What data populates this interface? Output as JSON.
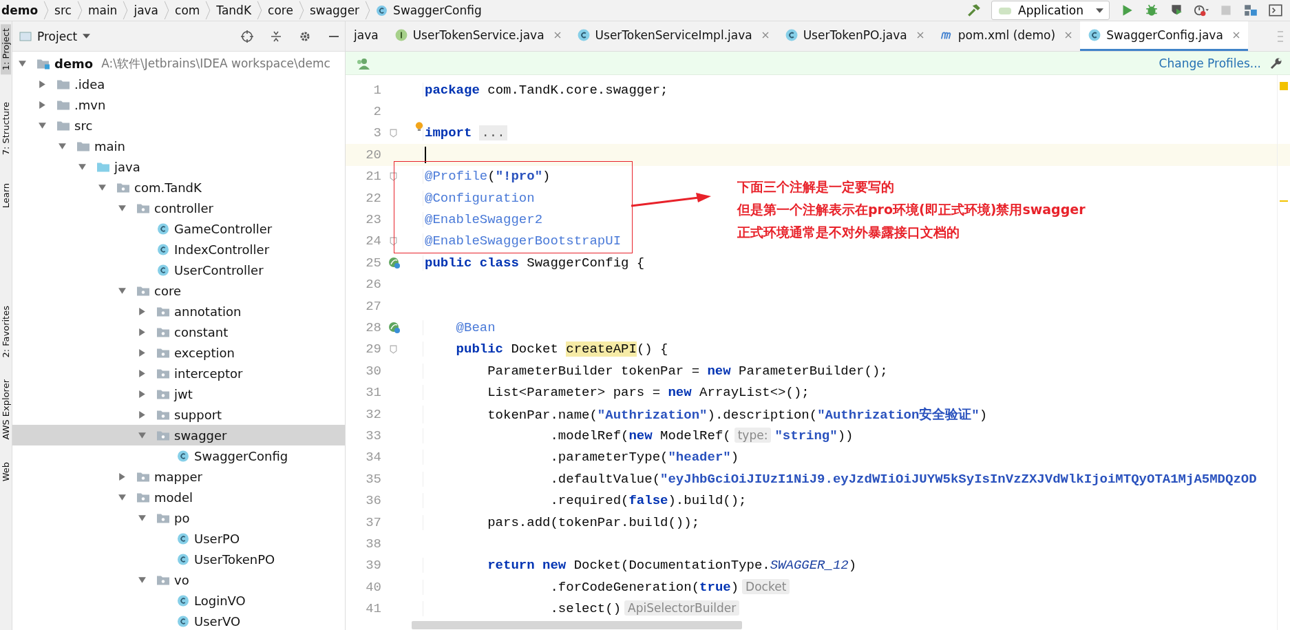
{
  "breadcrumbs": [
    {
      "label": "demo",
      "kind": "module"
    },
    {
      "label": "src",
      "kind": "folder"
    },
    {
      "label": "main",
      "kind": "folder"
    },
    {
      "label": "java",
      "kind": "folder"
    },
    {
      "label": "com",
      "kind": "folder"
    },
    {
      "label": "TandK",
      "kind": "folder"
    },
    {
      "label": "core",
      "kind": "folder"
    },
    {
      "label": "swagger",
      "kind": "folder"
    },
    {
      "label": "SwaggerConfig",
      "kind": "class"
    }
  ],
  "run_config": {
    "label": "Application"
  },
  "side_tabs": [
    {
      "label": "1: Project",
      "selected": true
    },
    {
      "label": "7: Structure",
      "selected": false
    },
    {
      "label": "Learn",
      "selected": false
    },
    {
      "label": "2: Favorites",
      "selected": false
    },
    {
      "label": "AWS Explorer",
      "selected": false
    },
    {
      "label": "Web",
      "selected": false
    }
  ],
  "project": {
    "title": "Project",
    "tree": [
      {
        "label": "demo",
        "kind": "module",
        "path": "A:\\软件\\Jetbrains\\IDEA workspace\\demc",
        "expanded": true,
        "selected": false,
        "children": [
          {
            "label": ".idea",
            "kind": "folder",
            "expanded": false,
            "selected": false
          },
          {
            "label": ".mvn",
            "kind": "folder",
            "expanded": false,
            "selected": false
          },
          {
            "label": "src",
            "kind": "folder",
            "expanded": true,
            "selected": false,
            "children": [
              {
                "label": "main",
                "kind": "folder",
                "expanded": true,
                "selected": false,
                "children": [
                  {
                    "label": "java",
                    "kind": "source",
                    "expanded": true,
                    "selected": false,
                    "children": [
                      {
                        "label": "com.TandK",
                        "kind": "package",
                        "expanded": true,
                        "selected": false,
                        "children": [
                          {
                            "label": "controller",
                            "kind": "package",
                            "expanded": true,
                            "selected": false,
                            "children": [
                              {
                                "label": "GameController",
                                "kind": "class",
                                "selected": false
                              },
                              {
                                "label": "IndexController",
                                "kind": "class",
                                "selected": false
                              },
                              {
                                "label": "UserController",
                                "kind": "class",
                                "selected": false
                              }
                            ]
                          },
                          {
                            "label": "core",
                            "kind": "package",
                            "expanded": true,
                            "selected": false,
                            "children": [
                              {
                                "label": "annotation",
                                "kind": "package",
                                "expanded": false,
                                "selected": false
                              },
                              {
                                "label": "constant",
                                "kind": "package",
                                "expanded": false,
                                "selected": false
                              },
                              {
                                "label": "exception",
                                "kind": "package",
                                "expanded": false,
                                "selected": false
                              },
                              {
                                "label": "interceptor",
                                "kind": "package",
                                "expanded": false,
                                "selected": false
                              },
                              {
                                "label": "jwt",
                                "kind": "package",
                                "expanded": false,
                                "selected": false
                              },
                              {
                                "label": "support",
                                "kind": "package",
                                "expanded": false,
                                "selected": false
                              },
                              {
                                "label": "swagger",
                                "kind": "package",
                                "expanded": true,
                                "selected": true,
                                "children": [
                                  {
                                    "label": "SwaggerConfig",
                                    "kind": "class",
                                    "selected": false
                                  }
                                ]
                              }
                            ]
                          },
                          {
                            "label": "mapper",
                            "kind": "package",
                            "expanded": false,
                            "selected": false
                          },
                          {
                            "label": "model",
                            "kind": "package",
                            "expanded": true,
                            "selected": false,
                            "children": [
                              {
                                "label": "po",
                                "kind": "package",
                                "expanded": true,
                                "selected": false,
                                "children": [
                                  {
                                    "label": "UserPO",
                                    "kind": "class",
                                    "selected": false
                                  },
                                  {
                                    "label": "UserTokenPO",
                                    "kind": "class",
                                    "selected": false
                                  }
                                ]
                              },
                              {
                                "label": "vo",
                                "kind": "package",
                                "expanded": true,
                                "selected": false,
                                "children": [
                                  {
                                    "label": "LoginVO",
                                    "kind": "class",
                                    "selected": false
                                  },
                                  {
                                    "label": "UserVO",
                                    "kind": "class",
                                    "selected": false
                                  }
                                ]
                              }
                            ]
                          }
                        ]
                      }
                    ]
                  }
                ]
              }
            ]
          }
        ]
      }
    ]
  },
  "tabs": [
    {
      "label": "java",
      "kind": "plain",
      "closable": false,
      "selected": false
    },
    {
      "label": "UserTokenService.java",
      "kind": "interface",
      "closable": true,
      "selected": false
    },
    {
      "label": "UserTokenServiceImpl.java",
      "kind": "class",
      "closable": true,
      "selected": false
    },
    {
      "label": "UserTokenPO.java",
      "kind": "class",
      "closable": true,
      "selected": false
    },
    {
      "label": "pom.xml (demo)",
      "kind": "maven",
      "closable": true,
      "selected": false
    },
    {
      "label": "SwaggerConfig.java",
      "kind": "class",
      "closable": true,
      "selected": true
    }
  ],
  "banner": {
    "link": "Change Profiles..."
  },
  "lines": [
    {
      "number": "1",
      "kind": "plain",
      "current": false,
      "intention": false,
      "tokens": [
        {
          "kind": "kw",
          "text": "package"
        },
        {
          "kind": "txt",
          "text": " com.TandK.core.swagger;"
        }
      ]
    },
    {
      "number": "2",
      "kind": "plain",
      "current": false,
      "intention": false
    },
    {
      "number": "3",
      "kind": "fold",
      "current": false,
      "intention": true,
      "tokens": [
        {
          "kind": "kw",
          "text": "import"
        },
        {
          "kind": "fold",
          "text": "..."
        }
      ]
    },
    {
      "number": "20",
      "kind": "plain",
      "current": true,
      "intention": false
    },
    {
      "number": "21",
      "kind": "fold",
      "current": false,
      "intention": false,
      "tokens": [
        {
          "kind": "ann",
          "text": "@Profile"
        },
        {
          "kind": "txt",
          "text": "("
        },
        {
          "kind": "str",
          "text": "\"!pro\""
        },
        {
          "kind": "txt",
          "text": ")"
        }
      ]
    },
    {
      "number": "22",
      "kind": "plain",
      "current": false,
      "intention": false,
      "tokens": [
        {
          "kind": "ann",
          "text": "@Configuration"
        }
      ]
    },
    {
      "number": "23",
      "kind": "plain",
      "current": false,
      "intention": false,
      "tokens": [
        {
          "kind": "ann",
          "text": "@EnableSwagger2"
        }
      ]
    },
    {
      "number": "24",
      "kind": "fold",
      "current": false,
      "intention": false,
      "tokens": [
        {
          "kind": "ann",
          "text": "@EnableSwaggerBootstrapUI"
        }
      ]
    },
    {
      "number": "25",
      "kind": "bean",
      "current": false,
      "intention": false,
      "tokens": [
        {
          "kind": "kw",
          "text": "public class"
        },
        {
          "kind": "txt",
          "text": " SwaggerConfig {"
        }
      ]
    },
    {
      "number": "26",
      "kind": "plain",
      "current": false,
      "intention": false
    },
    {
      "number": "27",
      "kind": "plain",
      "current": false,
      "intention": false
    },
    {
      "number": "28",
      "kind": "bean",
      "current": false,
      "intention": false,
      "tokens": [
        {
          "kind": "ann",
          "text": "    @Bean"
        }
      ]
    },
    {
      "number": "29",
      "kind": "fold",
      "current": false,
      "intention": false,
      "tokens": [
        {
          "kind": "kw",
          "text": "    public"
        },
        {
          "kind": "txt",
          "text": " Docket "
        },
        {
          "kind": "hl",
          "text": "createAPI"
        },
        {
          "kind": "txt",
          "text": "() {"
        }
      ]
    },
    {
      "number": "30",
      "current": false,
      "intention": false,
      "tokens": [
        {
          "kind": "txt",
          "text": "        ParameterBuilder tokenPar = "
        },
        {
          "kind": "kw",
          "text": "new"
        },
        {
          "kind": "txt",
          "text": " ParameterBuilder();"
        }
      ]
    },
    {
      "number": "31",
      "current": false,
      "intention": false,
      "tokens": [
        {
          "kind": "txt",
          "text": "        List<Parameter> pars = "
        },
        {
          "kind": "kw",
          "text": "new"
        },
        {
          "kind": "txt",
          "text": " ArrayList<>();"
        }
      ]
    },
    {
      "number": "32",
      "current": false,
      "intention": false,
      "tokens": [
        {
          "kind": "txt",
          "text": "        tokenPar.name("
        },
        {
          "kind": "str",
          "text": "\"Authrization\""
        },
        {
          "kind": "txt",
          "text": ").description("
        },
        {
          "kind": "str",
          "text": "\"Authrization安全验证\""
        },
        {
          "kind": "txt",
          "text": ")"
        }
      ]
    },
    {
      "number": "33",
      "current": false,
      "intention": false,
      "tokens": [
        {
          "kind": "txt",
          "text": "                .modelRef("
        },
        {
          "kind": "kw",
          "text": "new"
        },
        {
          "kind": "txt",
          "text": " ModelRef("
        },
        {
          "kind": "hint",
          "text": "type:"
        },
        {
          "kind": "str",
          "text": "\"string\""
        },
        {
          "kind": "txt",
          "text": "))"
        }
      ]
    },
    {
      "number": "34",
      "current": false,
      "intention": false,
      "tokens": [
        {
          "kind": "txt",
          "text": "                .parameterType("
        },
        {
          "kind": "str",
          "text": "\"header\""
        },
        {
          "kind": "txt",
          "text": ")"
        }
      ]
    },
    {
      "number": "35",
      "current": false,
      "intention": false,
      "tokens": [
        {
          "kind": "txt",
          "text": "                .defaultValue("
        },
        {
          "kind": "str",
          "text": "\"eyJhbGciOiJIUzI1NiJ9.eyJzdWIiOiJUYW5kSyIsInVzZXJVdWlkIjoiMTQyOTA1MjA5MDQzOD"
        }
      ]
    },
    {
      "number": "36",
      "current": false,
      "intention": false,
      "tokens": [
        {
          "kind": "txt",
          "text": "                .required("
        },
        {
          "kind": "kw",
          "text": "false"
        },
        {
          "kind": "txt",
          "text": ").build();"
        }
      ]
    },
    {
      "number": "37",
      "current": false,
      "intention": false,
      "tokens": [
        {
          "kind": "txt",
          "text": "        pars.add(tokenPar.build());"
        }
      ]
    },
    {
      "number": "38",
      "current": false,
      "intention": false
    },
    {
      "number": "39",
      "current": false,
      "intention": false,
      "tokens": [
        {
          "kind": "kw",
          "text": "        return new"
        },
        {
          "kind": "txt",
          "text": " Docket(DocumentationType."
        },
        {
          "kind": "const",
          "text": "SWAGGER_12"
        },
        {
          "kind": "txt",
          "text": ")"
        }
      ]
    },
    {
      "number": "40",
      "current": false,
      "intention": false,
      "tokens": [
        {
          "kind": "txt",
          "text": "                .forCodeGeneration("
        },
        {
          "kind": "kw",
          "text": "true"
        },
        {
          "kind": "txt",
          "text": ")"
        },
        {
          "kind": "hint",
          "text": "Docket"
        }
      ]
    },
    {
      "number": "41",
      "current": false,
      "intention": false,
      "tokens": [
        {
          "kind": "txt",
          "text": "                .select()"
        },
        {
          "kind": "hint",
          "text": "ApiSelectorBuilder"
        }
      ]
    }
  ],
  "note": {
    "lines": [
      "下面三个注解是一定要写的",
      "但是第一个注解表示在pro环境(即正式环境)禁用swagger",
      "正式环境通常是不对外暴露接口文档的"
    ]
  }
}
